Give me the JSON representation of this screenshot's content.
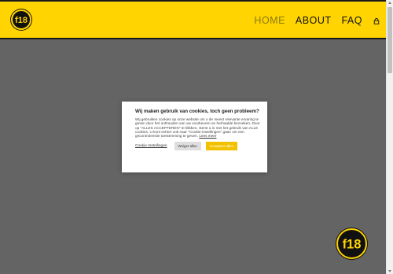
{
  "header": {
    "logo_icon": "f18-logo-icon",
    "logo_text": "f18",
    "background_color": "#FFD400",
    "nav": [
      {
        "label": "HOME",
        "active": true
      },
      {
        "label": "ABOUT",
        "active": false
      },
      {
        "label": "FAQ",
        "active": false
      }
    ],
    "cart_icon": "lock-bag-icon"
  },
  "cookie_modal": {
    "title": "Wij maken gebruik van cookies, toch geen probleem?",
    "body": "Wij gebruiken cookies op onze website om u de meest relevante ervaring te geven door het onthouden van uw voorkeuren en herhaalde bezoeken. Door op \"ALLES ACCEPTEREN\" te klikken, stemt u in met het gebruik van ALLE cookies. U kunt echter ook naar \"Cookie-instellingen\" gaan om een gecontroleerde toestemming te geven.",
    "read_more": "Lees meer",
    "settings_label": "Cookie Instellingen",
    "reject_label": "Weiger alles",
    "accept_label": "Accepteer alles",
    "accept_color": "#F2C200"
  },
  "floating_badge": {
    "icon": "f18-logo-icon",
    "text": "f18"
  }
}
